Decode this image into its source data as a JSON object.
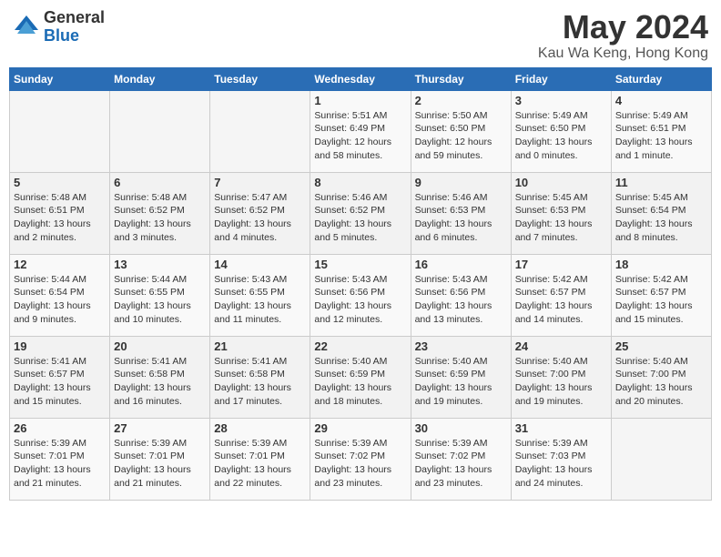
{
  "header": {
    "logo_general": "General",
    "logo_blue": "Blue",
    "month_year": "May 2024",
    "location": "Kau Wa Keng, Hong Kong"
  },
  "days_of_week": [
    "Sunday",
    "Monday",
    "Tuesday",
    "Wednesday",
    "Thursday",
    "Friday",
    "Saturday"
  ],
  "weeks": [
    [
      {
        "day": "",
        "info": ""
      },
      {
        "day": "",
        "info": ""
      },
      {
        "day": "",
        "info": ""
      },
      {
        "day": "1",
        "info": "Sunrise: 5:51 AM\nSunset: 6:49 PM\nDaylight: 12 hours\nand 58 minutes."
      },
      {
        "day": "2",
        "info": "Sunrise: 5:50 AM\nSunset: 6:50 PM\nDaylight: 12 hours\nand 59 minutes."
      },
      {
        "day": "3",
        "info": "Sunrise: 5:49 AM\nSunset: 6:50 PM\nDaylight: 13 hours\nand 0 minutes."
      },
      {
        "day": "4",
        "info": "Sunrise: 5:49 AM\nSunset: 6:51 PM\nDaylight: 13 hours\nand 1 minute."
      }
    ],
    [
      {
        "day": "5",
        "info": "Sunrise: 5:48 AM\nSunset: 6:51 PM\nDaylight: 13 hours\nand 2 minutes."
      },
      {
        "day": "6",
        "info": "Sunrise: 5:48 AM\nSunset: 6:52 PM\nDaylight: 13 hours\nand 3 minutes."
      },
      {
        "day": "7",
        "info": "Sunrise: 5:47 AM\nSunset: 6:52 PM\nDaylight: 13 hours\nand 4 minutes."
      },
      {
        "day": "8",
        "info": "Sunrise: 5:46 AM\nSunset: 6:52 PM\nDaylight: 13 hours\nand 5 minutes."
      },
      {
        "day": "9",
        "info": "Sunrise: 5:46 AM\nSunset: 6:53 PM\nDaylight: 13 hours\nand 6 minutes."
      },
      {
        "day": "10",
        "info": "Sunrise: 5:45 AM\nSunset: 6:53 PM\nDaylight: 13 hours\nand 7 minutes."
      },
      {
        "day": "11",
        "info": "Sunrise: 5:45 AM\nSunset: 6:54 PM\nDaylight: 13 hours\nand 8 minutes."
      }
    ],
    [
      {
        "day": "12",
        "info": "Sunrise: 5:44 AM\nSunset: 6:54 PM\nDaylight: 13 hours\nand 9 minutes."
      },
      {
        "day": "13",
        "info": "Sunrise: 5:44 AM\nSunset: 6:55 PM\nDaylight: 13 hours\nand 10 minutes."
      },
      {
        "day": "14",
        "info": "Sunrise: 5:43 AM\nSunset: 6:55 PM\nDaylight: 13 hours\nand 11 minutes."
      },
      {
        "day": "15",
        "info": "Sunrise: 5:43 AM\nSunset: 6:56 PM\nDaylight: 13 hours\nand 12 minutes."
      },
      {
        "day": "16",
        "info": "Sunrise: 5:43 AM\nSunset: 6:56 PM\nDaylight: 13 hours\nand 13 minutes."
      },
      {
        "day": "17",
        "info": "Sunrise: 5:42 AM\nSunset: 6:57 PM\nDaylight: 13 hours\nand 14 minutes."
      },
      {
        "day": "18",
        "info": "Sunrise: 5:42 AM\nSunset: 6:57 PM\nDaylight: 13 hours\nand 15 minutes."
      }
    ],
    [
      {
        "day": "19",
        "info": "Sunrise: 5:41 AM\nSunset: 6:57 PM\nDaylight: 13 hours\nand 15 minutes."
      },
      {
        "day": "20",
        "info": "Sunrise: 5:41 AM\nSunset: 6:58 PM\nDaylight: 13 hours\nand 16 minutes."
      },
      {
        "day": "21",
        "info": "Sunrise: 5:41 AM\nSunset: 6:58 PM\nDaylight: 13 hours\nand 17 minutes."
      },
      {
        "day": "22",
        "info": "Sunrise: 5:40 AM\nSunset: 6:59 PM\nDaylight: 13 hours\nand 18 minutes."
      },
      {
        "day": "23",
        "info": "Sunrise: 5:40 AM\nSunset: 6:59 PM\nDaylight: 13 hours\nand 19 minutes."
      },
      {
        "day": "24",
        "info": "Sunrise: 5:40 AM\nSunset: 7:00 PM\nDaylight: 13 hours\nand 19 minutes."
      },
      {
        "day": "25",
        "info": "Sunrise: 5:40 AM\nSunset: 7:00 PM\nDaylight: 13 hours\nand 20 minutes."
      }
    ],
    [
      {
        "day": "26",
        "info": "Sunrise: 5:39 AM\nSunset: 7:01 PM\nDaylight: 13 hours\nand 21 minutes."
      },
      {
        "day": "27",
        "info": "Sunrise: 5:39 AM\nSunset: 7:01 PM\nDaylight: 13 hours\nand 21 minutes."
      },
      {
        "day": "28",
        "info": "Sunrise: 5:39 AM\nSunset: 7:01 PM\nDaylight: 13 hours\nand 22 minutes."
      },
      {
        "day": "29",
        "info": "Sunrise: 5:39 AM\nSunset: 7:02 PM\nDaylight: 13 hours\nand 23 minutes."
      },
      {
        "day": "30",
        "info": "Sunrise: 5:39 AM\nSunset: 7:02 PM\nDaylight: 13 hours\nand 23 minutes."
      },
      {
        "day": "31",
        "info": "Sunrise: 5:39 AM\nSunset: 7:03 PM\nDaylight: 13 hours\nand 24 minutes."
      },
      {
        "day": "",
        "info": ""
      }
    ]
  ]
}
